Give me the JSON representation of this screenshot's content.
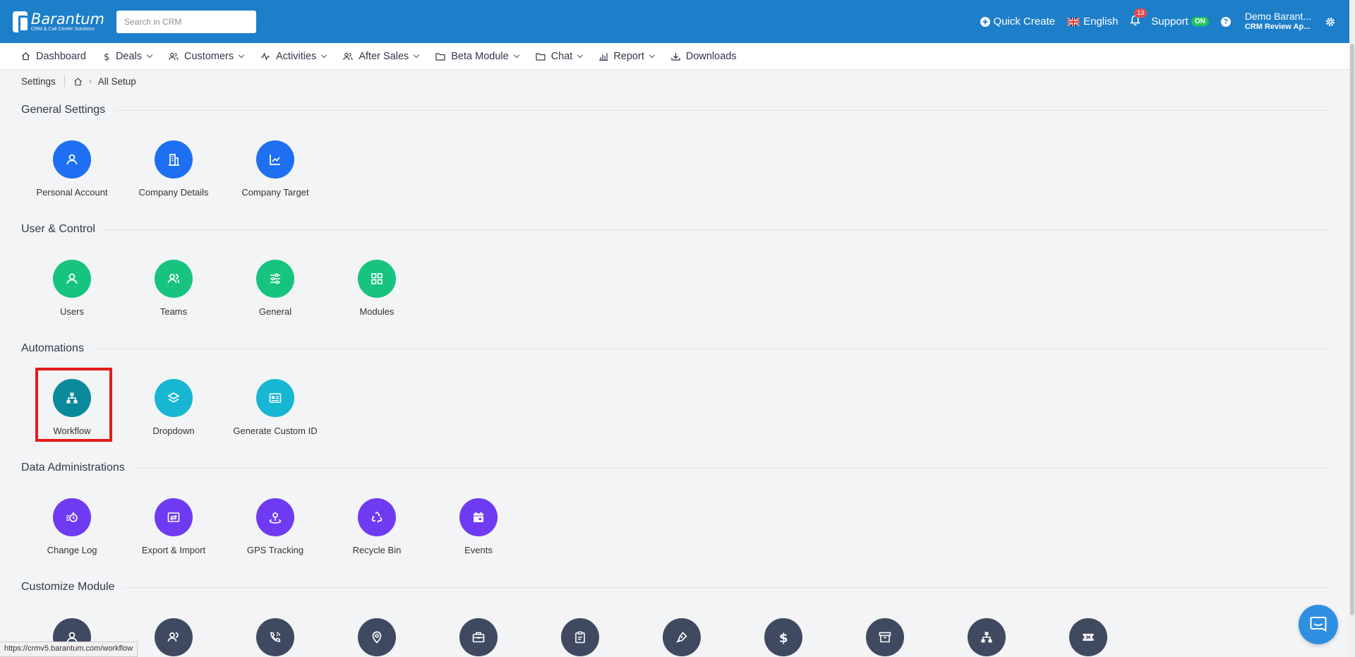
{
  "header": {
    "logo_name": "Barantum",
    "logo_sub": "CRM & Call Center Solutions",
    "search_placeholder": "Search in CRM",
    "quick_create": "Quick Create",
    "language": "English",
    "notification_count": "13",
    "support": "Support",
    "support_status": "ON",
    "help": "?",
    "user_name": "Demo Barant...",
    "user_sub": "CRM Review Ap..."
  },
  "nav": {
    "items": [
      {
        "label": "Dashboard",
        "icon": "home-icon",
        "dropdown": false
      },
      {
        "label": "Deals",
        "icon": "dollar-icon",
        "dropdown": true
      },
      {
        "label": "Customers",
        "icon": "users-icon",
        "dropdown": true
      },
      {
        "label": "Activities",
        "icon": "activity-icon",
        "dropdown": true
      },
      {
        "label": "After Sales",
        "icon": "users-icon",
        "dropdown": true
      },
      {
        "label": "Beta Module",
        "icon": "folder-icon",
        "dropdown": true
      },
      {
        "label": "Chat",
        "icon": "folder-icon",
        "dropdown": true
      },
      {
        "label": "Report",
        "icon": "bar-chart-icon",
        "dropdown": true
      },
      {
        "label": "Downloads",
        "icon": "download-icon",
        "dropdown": false
      }
    ]
  },
  "breadcrumb": {
    "root": "Settings",
    "current": "All Setup"
  },
  "sections": {
    "general": {
      "title": "General Settings",
      "items": [
        "Personal Account",
        "Company Details",
        "Company Target"
      ]
    },
    "user_control": {
      "title": "User & Control",
      "items": [
        "Users",
        "Teams",
        "General",
        "Modules"
      ]
    },
    "automations": {
      "title": "Automations",
      "items": [
        "Workflow",
        "Dropdown",
        "Generate Custom ID"
      ]
    },
    "data_admin": {
      "title": "Data Administrations",
      "items": [
        "Change Log",
        "Export & Import",
        "GPS Tracking",
        "Recycle Bin",
        "Events"
      ]
    },
    "customize": {
      "title": "Customize Module"
    }
  },
  "status_url": "https://crmv5.barantum.com/workflow",
  "colors": {
    "header": "#1d7fc9",
    "blue": "#1e6ff2",
    "green": "#16c47f",
    "teal": "#0b8a9b",
    "cyan": "#17b6d3",
    "purple": "#6e3bf2",
    "slate": "#3f4a60",
    "highlight": "#e41b1b"
  }
}
